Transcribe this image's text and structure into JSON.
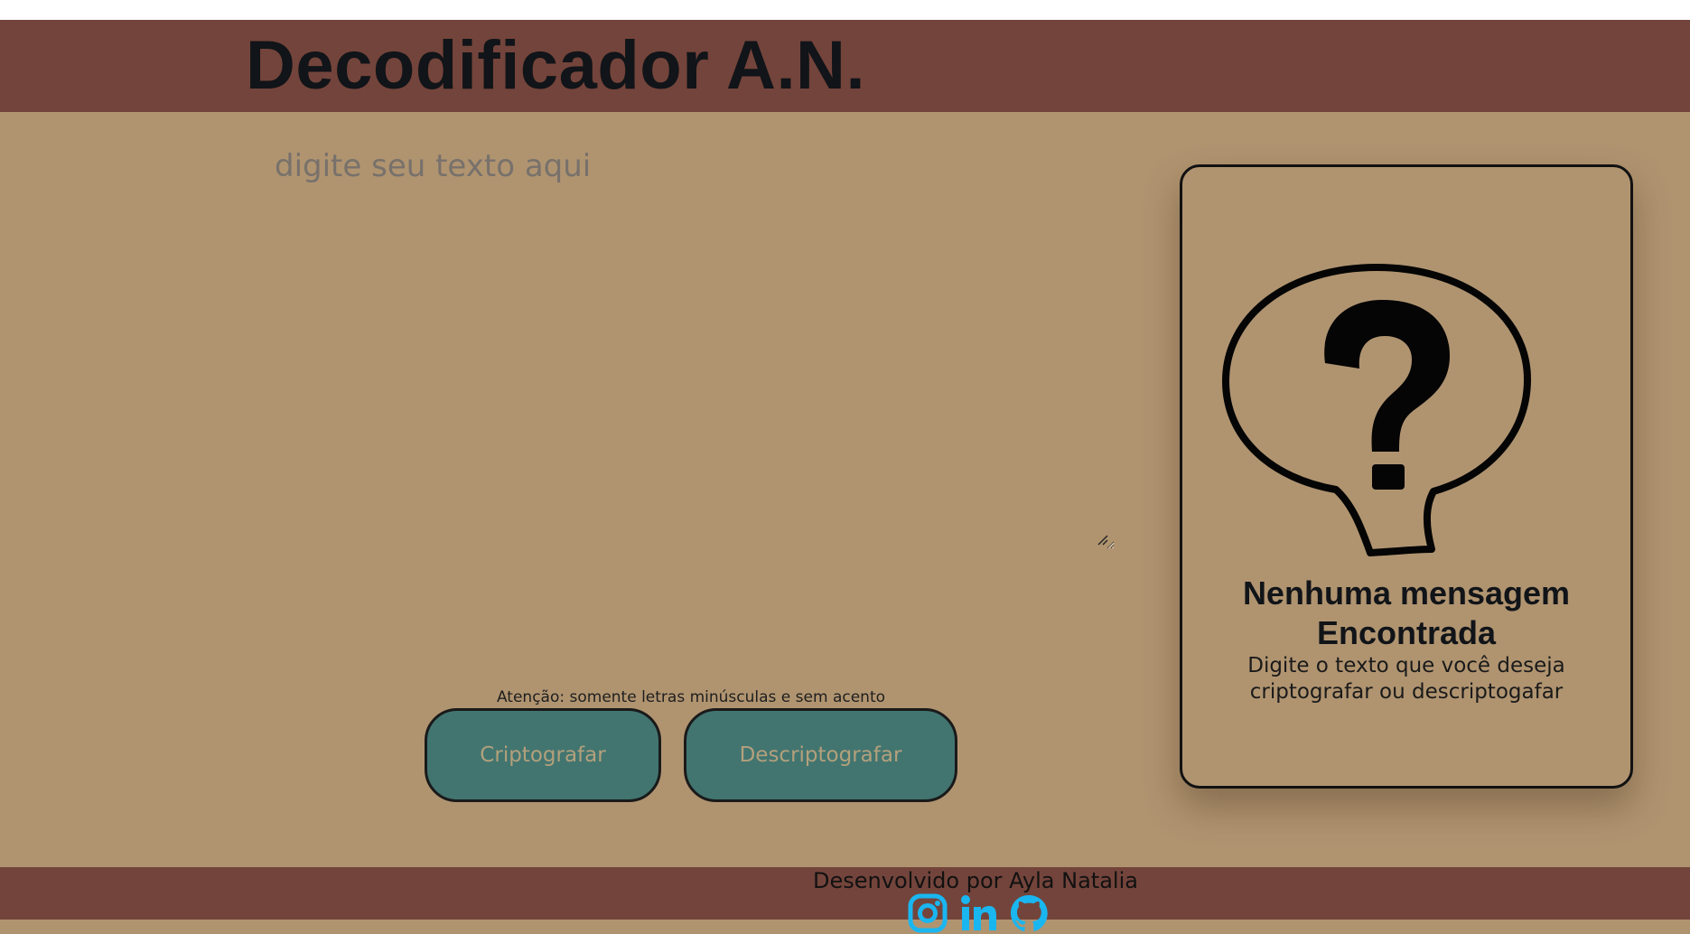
{
  "header": {
    "title": "Decodificador A.N."
  },
  "input": {
    "placeholder": "digite seu texto aqui",
    "value": ""
  },
  "hint": "Atenção: somente letras minúsculas e sem acento",
  "buttons": {
    "encrypt": "Criptografar",
    "decrypt": "Descriptografar"
  },
  "output": {
    "icon": "question-speech-bubble-icon",
    "title": "Nenhuma mensagem Encontrada",
    "text": "Digite o texto que você deseja criptografar ou descriptogafar"
  },
  "footer": {
    "credit": "Desenvolvido por Ayla Natalia",
    "social": [
      "instagram-icon",
      "linkedin-icon",
      "github-icon"
    ]
  },
  "colors": {
    "header_bg": "#73443b",
    "page_bg": "#b09470",
    "button_bg": "#427570",
    "button_text": "#b3a07c",
    "social_icon": "#1ab6f0"
  }
}
